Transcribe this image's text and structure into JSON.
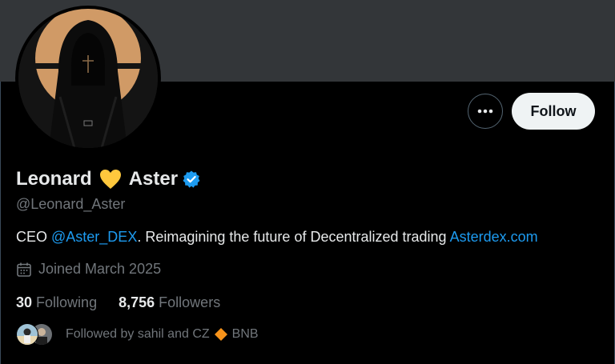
{
  "profile": {
    "name_first": "Leonard",
    "name_second": "Aster",
    "handle": "@Leonard_Aster",
    "bio_prefix": "CEO ",
    "bio_mention": "@Aster_DEX",
    "bio_middle": ". Reimagining the future of Decentralized trading ",
    "bio_link": "Asterdex.com",
    "joined": "Joined March 2025",
    "following_count": "30",
    "following_label": "Following",
    "followers_count": "8,756",
    "followers_label": "Followers",
    "followed_by_prefix": "Followed by sahil and CZ",
    "followed_by_suffix": "BNB"
  },
  "actions": {
    "follow_label": "Follow"
  },
  "icons": {
    "more": "more-horizontal-icon",
    "heart": "yellow-heart-icon",
    "verified": "verified-badge-icon",
    "calendar": "calendar-icon",
    "diamond": "orange-diamond-icon"
  },
  "colors": {
    "background": "#000000",
    "banner": "#333639",
    "link": "#1d9bf0",
    "muted": "#71767b",
    "follow_button_bg": "#eff3f4",
    "heart": "#ffc83d",
    "diamond": "#f7931a"
  }
}
